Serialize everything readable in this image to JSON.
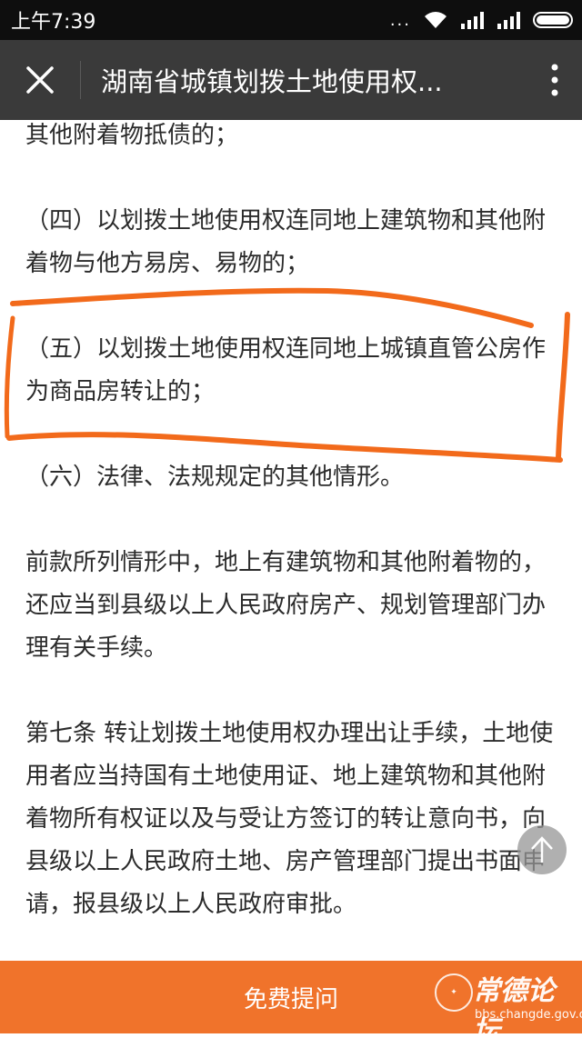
{
  "status_bar": {
    "time": "上午7:39",
    "dots": "...",
    "icons": [
      "wifi-icon",
      "signal-icon",
      "signal-icon",
      "battery-icon"
    ]
  },
  "title_bar": {
    "title": "湖南省城镇划拨土地使用权..."
  },
  "article": {
    "paragraphs": [
      "其他附着物抵债的；",
      "（四）以划拨土地使用权连同地上建筑物和其他附着物与他方易房、易物的；",
      "（五）以划拨土地使用权连同地上城镇直管公房作为商品房转让的；",
      "（六）法律、法规规定的其他情形。",
      "前款所列情形中，地上有建筑物和其他附着物的，还应当到县级以上人民政府房产、规划管理部门办理有关手续。",
      "第七条 转让划拨土地使用权办理出让手续，土地使用者应当持国有土地使用证、地上建筑物和其他附着物所有权证以及与受让方签订的转让意向书，向县级以上人民政府土地、房产管理部门提出书面申请，报县级以上人民政府审批。"
    ]
  },
  "bottom_bar": {
    "ask_label": "免费提问",
    "watermark_name": "常德论坛",
    "watermark_url": "bbs.changde.gov.cn"
  },
  "colors": {
    "accent": "#f0732b",
    "title_bar": "#3a3a3a",
    "status_bar": "#0e0e0e",
    "annotation": "#f26a1b"
  }
}
